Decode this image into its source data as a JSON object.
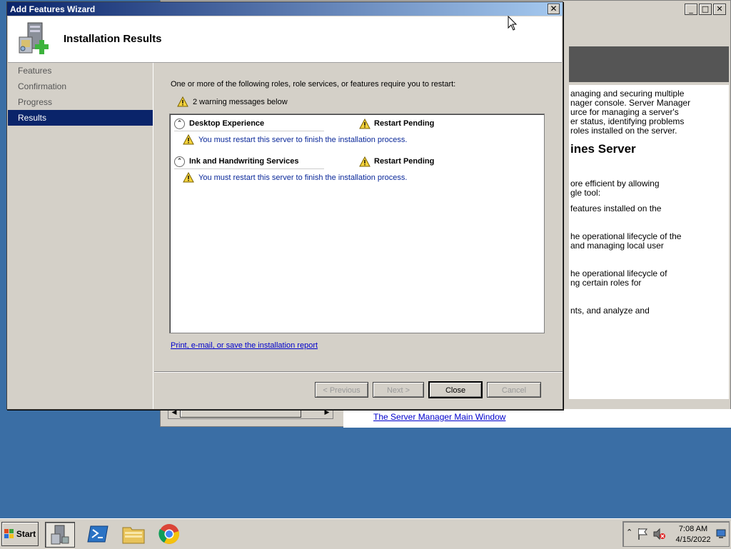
{
  "background_window": {
    "paragraph1": "anaging and securing multiple\nnager console. Server Manager\nurce for managing a server's\ner status, identifying problems\n roles installed on the server.",
    "heading": "ines Server",
    "paragraph2": "ore efficient by allowing\ngle tool:",
    "paragraph3": "features installed on the",
    "paragraph4": "he operational lifecycle of the\n and managing local user",
    "paragraph5": "he operational lifecycle of\nng certain roles for",
    "paragraph6": "nts, and analyze and",
    "link": "The Server Manager Main Window"
  },
  "wizard": {
    "title": "Add Features Wizard",
    "header_title": "Installation Results",
    "nav": [
      "Features",
      "Confirmation",
      "Progress",
      "Results"
    ],
    "active_nav": "Results",
    "intro": "One or more of the following roles, role services, or features require you to restart:",
    "warning_summary": "2 warning messages below",
    "results": [
      {
        "name": "Desktop Experience",
        "status": "Restart Pending",
        "message": "You must restart this server to finish the installation process."
      },
      {
        "name": "Ink and Handwriting Services",
        "status": "Restart Pending",
        "message": "You must restart this server to finish the installation process."
      }
    ],
    "report_link": "Print, e-mail, or save the installation report",
    "buttons": {
      "previous": "< Previous",
      "next": "Next >",
      "close": "Close",
      "cancel": "Cancel"
    }
  },
  "taskbar": {
    "start": "Start",
    "time": "7:08 AM",
    "date": "4/15/2022",
    "icons": [
      "server-manager-icon",
      "powershell-icon",
      "explorer-icon",
      "chrome-icon"
    ]
  },
  "colors": {
    "desktop": "#3a6ea5",
    "title_active": "#0a246a",
    "link": "#0000cc",
    "message_text": "#0a2899"
  }
}
